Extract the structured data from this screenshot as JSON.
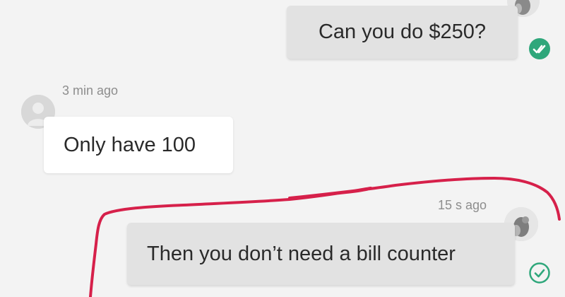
{
  "messages": [
    {
      "id": "m1",
      "direction": "outgoing",
      "text": "Can you do $250?",
      "status": "read",
      "status_icon": "double-check-icon"
    },
    {
      "id": "m2",
      "direction": "incoming",
      "text": "Only have 100",
      "timestamp": "3 min ago",
      "avatar": "default-user-avatar"
    },
    {
      "id": "m3",
      "direction": "outgoing",
      "text": "Then you don’t need a bill counter",
      "timestamp": "15 s ago",
      "status": "sent",
      "status_icon": "check-outline-icon"
    }
  ],
  "colors": {
    "read_check": "#2fa77b",
    "sent_check": "#2fa77b",
    "annotation_circle": "#d6204a"
  }
}
